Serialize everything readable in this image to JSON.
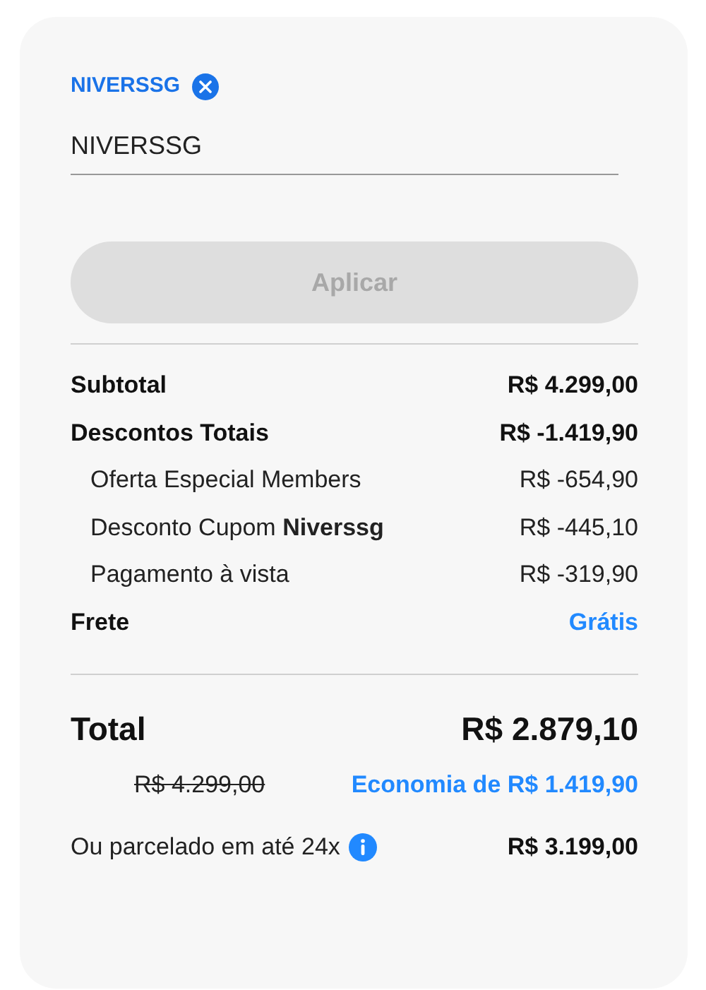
{
  "coupon": {
    "tag": "NIVERSSG",
    "input_value": "NIVERSSG",
    "apply_button": {
      "label": "Aplicar",
      "disabled": true
    }
  },
  "summary": [
    {
      "kind": "main",
      "label": "Subtotal",
      "value": "R$ 4.299,00",
      "accent": false
    },
    {
      "kind": "main",
      "label": "Descontos Totais",
      "value": "R$ -1.419,90",
      "accent": false
    },
    {
      "kind": "sub",
      "label": "Oferta Especial Members",
      "value": "R$ -654,90",
      "accent": false
    },
    {
      "kind": "sub",
      "label": "Desconto Cupom **Niverssg**",
      "value": "R$ -445,10",
      "accent": false
    },
    {
      "kind": "sub",
      "label": "Pagamento à vista",
      "value": "R$ -319,90",
      "accent": false
    },
    {
      "kind": "main",
      "label": "Frete",
      "value": "Grátis",
      "accent": true
    }
  ],
  "total": {
    "label": "Total",
    "value": "R$ 2.879,10",
    "old_price": "R$ 4.299,00",
    "savings": "Economia de R$ 1.419,90"
  },
  "installments": {
    "label": "Ou parcelado em até 24x",
    "value": "R$ 3.199,00"
  }
}
